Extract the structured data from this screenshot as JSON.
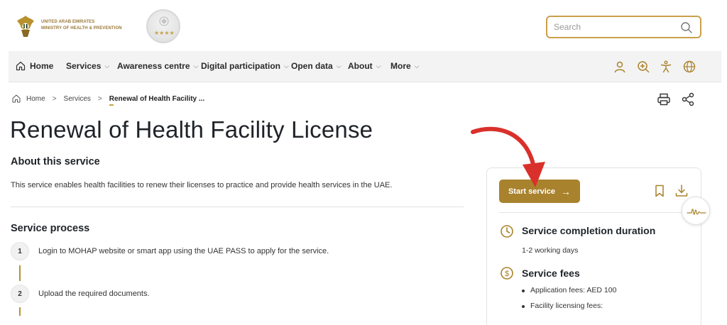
{
  "header": {
    "brand_line1": "UNITED ARAB EMIRATES",
    "brand_line2": "MINISTRY OF HEALTH & PREVENTION",
    "award_stars": "★★★★",
    "search": {
      "placeholder": "Search",
      "value": ""
    }
  },
  "nav": {
    "items": [
      {
        "label": "Home"
      },
      {
        "label": "Services"
      },
      {
        "label": "Awareness centre"
      },
      {
        "label": "Digital participation"
      },
      {
        "label": "Open data"
      },
      {
        "label": "About"
      },
      {
        "label": "More"
      }
    ],
    "icons": [
      "user-icon",
      "zoom-in-icon",
      "accessibility-icon",
      "globe-icon"
    ]
  },
  "breadcrumb": {
    "items": [
      "Home",
      "Services",
      "Renewal of Health Facility ..."
    ],
    "separator": ">"
  },
  "page": {
    "title": "Renewal of Health Facility License",
    "about_heading": "About this service",
    "about_text": "This service enables health facilities to renew their licenses to practice and provide health services in the UAE.",
    "process_heading": "Service process",
    "steps": [
      {
        "num": "1",
        "text": "Login to MOHAP website or smart app using the UAE PASS to apply for the service."
      },
      {
        "num": "2",
        "text": "Upload the required documents."
      }
    ]
  },
  "card": {
    "start_button": "Start service",
    "start_arrow": "→",
    "duration_heading": "Service completion duration",
    "duration_value": "1-2 working days",
    "fees_heading": "Service fees",
    "fees": [
      "Application fees: AED 100",
      "Facility licensing fees:"
    ]
  },
  "colors": {
    "accent_gold": "#a9822d",
    "gold_border": "#c9a14a",
    "pointer_red": "#d9302b"
  }
}
